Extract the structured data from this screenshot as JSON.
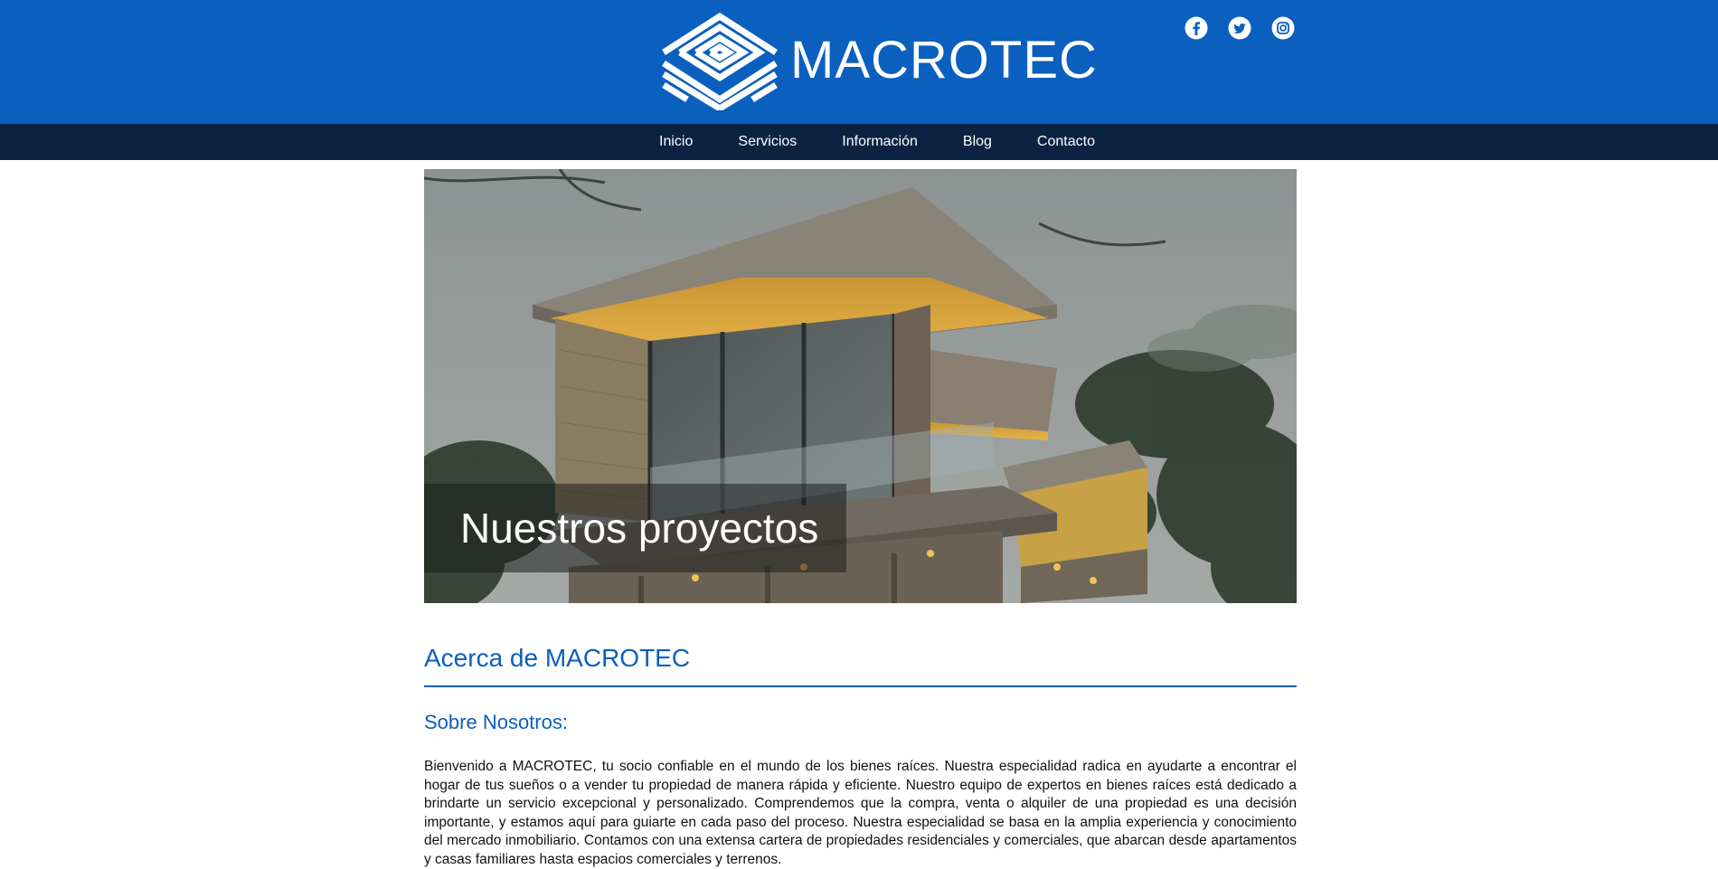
{
  "brand": {
    "name": "MACROTEC",
    "primary_color": "#0a5fbf",
    "nav_color": "#0b2341"
  },
  "social": [
    {
      "name": "facebook-icon"
    },
    {
      "name": "twitter-icon"
    },
    {
      "name": "instagram-icon"
    }
  ],
  "nav": {
    "items": [
      {
        "label": "Inicio"
      },
      {
        "label": "Servicios"
      },
      {
        "label": "Información"
      },
      {
        "label": "Blog"
      },
      {
        "label": "Contacto"
      }
    ]
  },
  "hero": {
    "title": "Nuestros proyectos"
  },
  "about": {
    "heading": "Acerca de MACROTEC",
    "subheading": "Sobre Nosotros:",
    "body": "Bienvenido a MACROTEC, tu socio confiable en el mundo de los bienes raíces. Nuestra especialidad radica en ayudarte a encontrar el hogar de tus sueños o a vender tu propiedad de manera rápida y eficiente. Nuestro equipo de expertos en bienes raíces está dedicado a brindarte un servicio excepcional y personalizado. Comprendemos que la compra, venta o alquiler de una propiedad es una decisión importante, y estamos aquí para guiarte en cada paso del proceso. Nuestra especialidad se basa en la amplia experiencia y conocimiento del mercado inmobiliario. Contamos con una extensa cartera de propiedades residenciales y comerciales, que abarcan desde apartamentos y casas familiares hasta espacios comerciales y terrenos."
  }
}
